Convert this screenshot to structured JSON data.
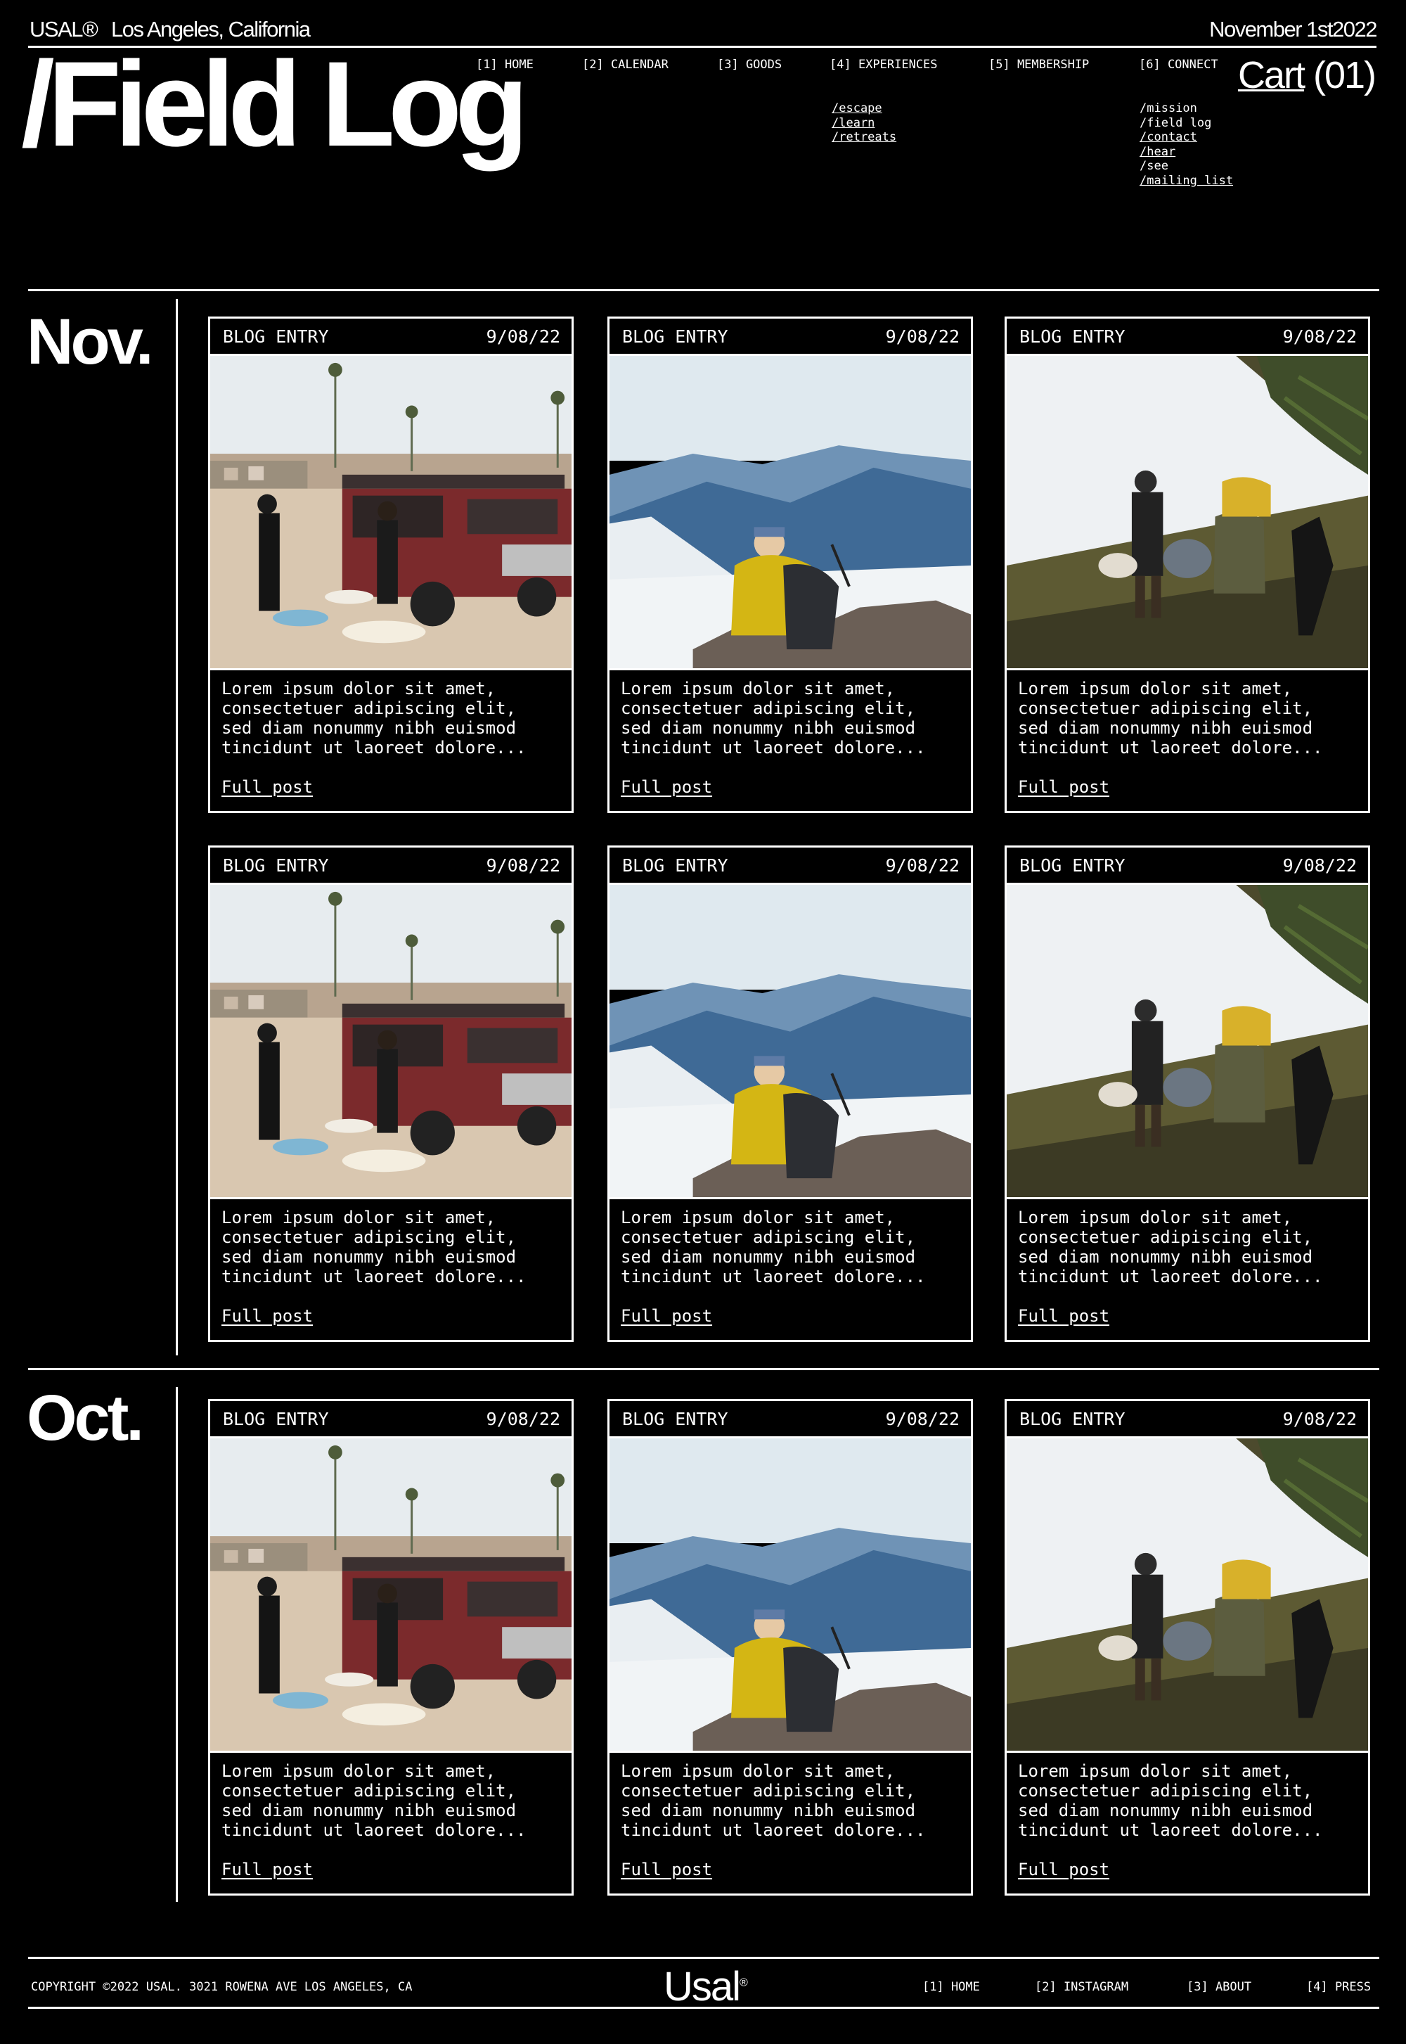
{
  "header": {
    "brand": "USAL®",
    "location": "Los Angeles, California",
    "date": "November 1st2022",
    "title": "/Field Log",
    "cart_label": "Cart",
    "cart_count": "(01)"
  },
  "nav": [
    {
      "label": "[1] HOME"
    },
    {
      "label": "[2] CALENDAR"
    },
    {
      "label": "[3] GOODS"
    },
    {
      "label": "[4] EXPERIENCES"
    },
    {
      "label": "[5] MEMBERSHIP"
    },
    {
      "label": "[6] CONNECT"
    }
  ],
  "experiences_sub": [
    "/escape",
    "/learn",
    "/retreats"
  ],
  "connect_sub": [
    "/mission",
    "/field log",
    "/contact",
    "/hear",
    "/see",
    "/mailing list"
  ],
  "sections": [
    {
      "month": "Nov."
    },
    {
      "month": "Oct."
    }
  ],
  "card": {
    "label": "BLOG ENTRY",
    "date": "9/08/22",
    "excerpt": "Lorem ipsum dolor sit amet,\nconsectetuer adipiscing elit,\nsed diam nonummy nibh euismod\ntincidunt ut laoreet dolore...",
    "link": "Full post"
  },
  "photos": [
    "surf-van-beach-photo",
    "mountain-hiker-dog-photo",
    "snow-hiking-group-photo"
  ],
  "footer": {
    "copyright": "COPYRIGHT ©2022 USAL. 3021 ROWENA AVE LOS ANGELES, CA",
    "logo": "Usal",
    "logo_mark": "®",
    "links": [
      "[1] HOME",
      "[2] INSTAGRAM",
      "[3] ABOUT",
      "[4] PRESS"
    ]
  }
}
